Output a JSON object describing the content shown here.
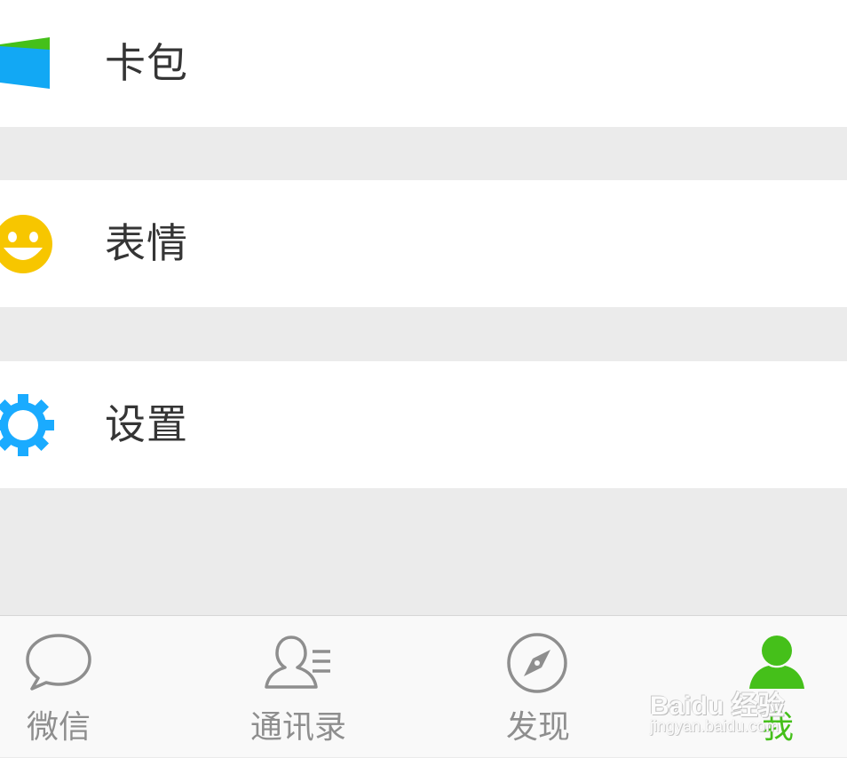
{
  "menu": {
    "items": [
      {
        "label": "卡包",
        "icon": "card-wallet-icon"
      },
      {
        "label": "表情",
        "icon": "smiley-face-icon"
      },
      {
        "label": "设置",
        "icon": "gear-icon"
      }
    ]
  },
  "tabbar": {
    "tabs": [
      {
        "label": "微信",
        "icon": "chat-bubble-icon",
        "active": false
      },
      {
        "label": "通讯录",
        "icon": "contacts-icon",
        "active": false
      },
      {
        "label": "发现",
        "icon": "compass-icon",
        "active": false
      },
      {
        "label": "我",
        "icon": "person-icon",
        "active": true
      }
    ]
  },
  "watermark": {
    "main": "Baidu 经验",
    "sub": "jingyan.baidu.com"
  },
  "colors": {
    "active": "#45c01a",
    "inactive": "#8e8e8e",
    "wallet_blue": "#12a8f4",
    "wallet_green": "#45c01a",
    "smiley_yellow": "#f7c600",
    "gear_blue": "#1aabff",
    "separator": "#ebebeb"
  }
}
